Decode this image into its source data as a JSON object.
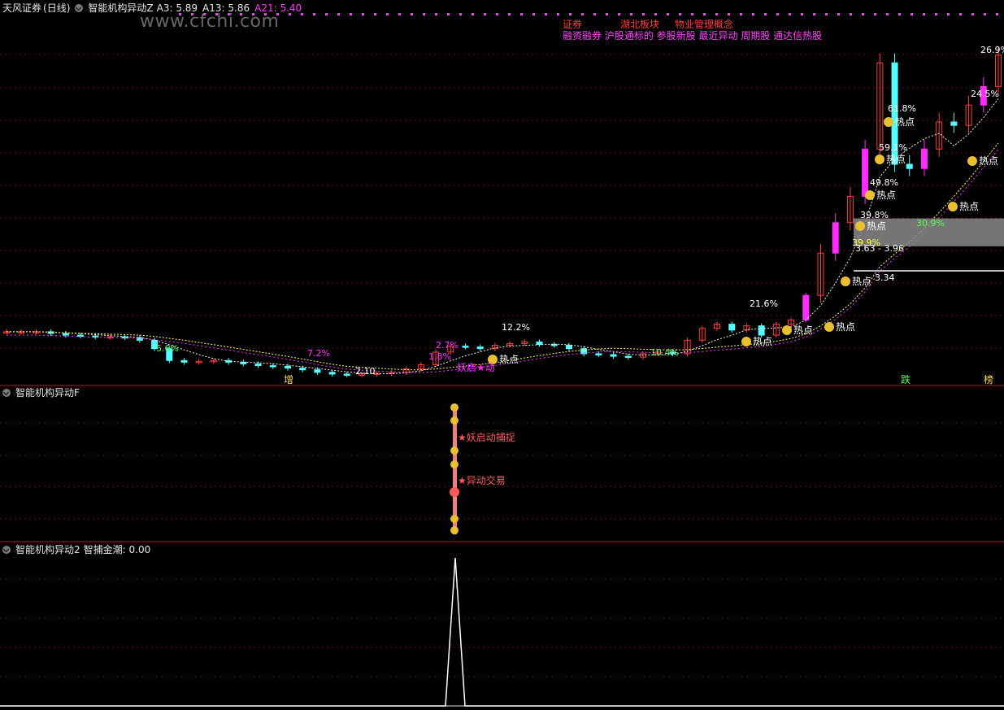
{
  "header": {
    "stock_name": "天风证券",
    "period": "(日线)",
    "indicator_name": "智能机构异动Z",
    "a3": "A3: 5.89",
    "a13": "A13: 5.86",
    "a21": "A21: 5.40"
  },
  "watermark": "www.cfchi.com",
  "concept_tags": {
    "row1": [
      "证券",
      "湖北板块",
      "物业管理概念"
    ],
    "row2": "融资融券 沪股通标的 参股新股 最近异动 周期股 通达信热股"
  },
  "markers": {
    "increase": "增",
    "drop": "跌",
    "ranking": "榜"
  },
  "price_labels": {
    "low": "2.10",
    "zone_range": "3.63 - 3.96",
    "support": "3.34",
    "pct_labels": [
      "5.6%",
      "7.2%",
      "2.7%",
      "1.8%",
      "12.2%",
      "10.4%",
      "21.6%",
      "39.9%",
      "39.8%",
      "49.8%",
      "59.1%",
      "61.8%",
      "24.5%",
      "26.9%",
      "30.9%"
    ],
    "hot_point": "热点",
    "yao_start": "妖启★动"
  },
  "panel2": {
    "title": "智能机构异动F",
    "label_capture": "★妖启动捕捉",
    "label_trade": "★异动交易"
  },
  "panel3": {
    "title": "智能机构异动2",
    "value_label": "智捕金潮: 0.00"
  },
  "colors": {
    "up": "#ff3c3c",
    "down": "#54ffff",
    "magenta": "#ff2cff",
    "yellow": "#ffff54",
    "grid": "#5a1414",
    "divider": "#b01c1c"
  },
  "chart_data": {
    "type": "candlestick",
    "series": [
      {
        "name": "A3",
        "value": 5.89
      },
      {
        "name": "A13",
        "value": 5.86
      },
      {
        "name": "A21",
        "value": 5.4
      }
    ],
    "price_levels": {
      "low": 2.1,
      "zone": [
        3.63,
        3.96
      ],
      "support": 3.34
    },
    "candles_close_approx": [
      2.62,
      2.62,
      2.62,
      2.6,
      2.58,
      2.57,
      2.56,
      2.56,
      2.55,
      2.52,
      2.42,
      2.28,
      2.26,
      2.27,
      2.28,
      2.26,
      2.24,
      2.22,
      2.21,
      2.19,
      2.17,
      2.14,
      2.12,
      2.11,
      2.12,
      2.13,
      2.14,
      2.18,
      2.23,
      2.38,
      2.45,
      2.44,
      2.42,
      2.46,
      2.48,
      2.5,
      2.47,
      2.46,
      2.42,
      2.36,
      2.35,
      2.33,
      2.32,
      2.36,
      2.38,
      2.36,
      2.52,
      2.66,
      2.71,
      2.64,
      2.69,
      2.58,
      2.71,
      2.76,
      3.05,
      3.55,
      3.91,
      4.22,
      4.78,
      5.8,
      4.6,
      4.55,
      4.78,
      5.1,
      5.06,
      5.3,
      5.52,
      5.89
    ],
    "panel3_series": {
      "name": "智捕金潮",
      "last": 0.0,
      "spike_at_index": 44
    }
  }
}
